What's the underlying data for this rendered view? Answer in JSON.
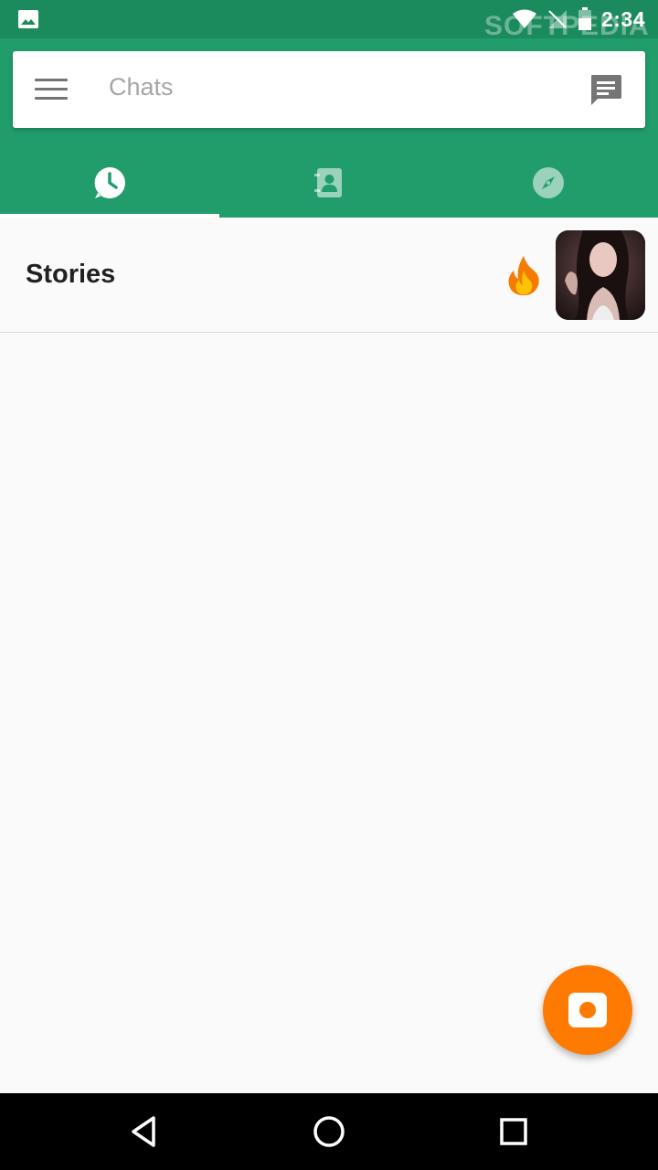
{
  "status_bar": {
    "time": "2:34",
    "watermark": "SOFTPEDIA",
    "icons": [
      "gallery-icon",
      "wifi-icon",
      "signal-icon",
      "battery-icon"
    ]
  },
  "search_bar": {
    "placeholder": "Chats",
    "menu_icon": "menu-icon",
    "action_icon": "message-icon"
  },
  "tabs": [
    {
      "icon": "clock-icon",
      "selected": true
    },
    {
      "icon": "contacts-icon",
      "selected": false
    },
    {
      "icon": "compass-icon",
      "selected": false
    }
  ],
  "stories": {
    "title": "Stories",
    "badge": "🔥",
    "thumbnail": "story-thumbnail"
  },
  "fab": {
    "icon": "camera-icon"
  },
  "nav_bar": {
    "icons": [
      "back-icon",
      "home-icon",
      "recents-icon"
    ]
  },
  "colors": {
    "status_bar": "#1b8a5c",
    "app_bar": "#219c6b",
    "fab": "#ff7a00",
    "background": "#fafafa"
  }
}
